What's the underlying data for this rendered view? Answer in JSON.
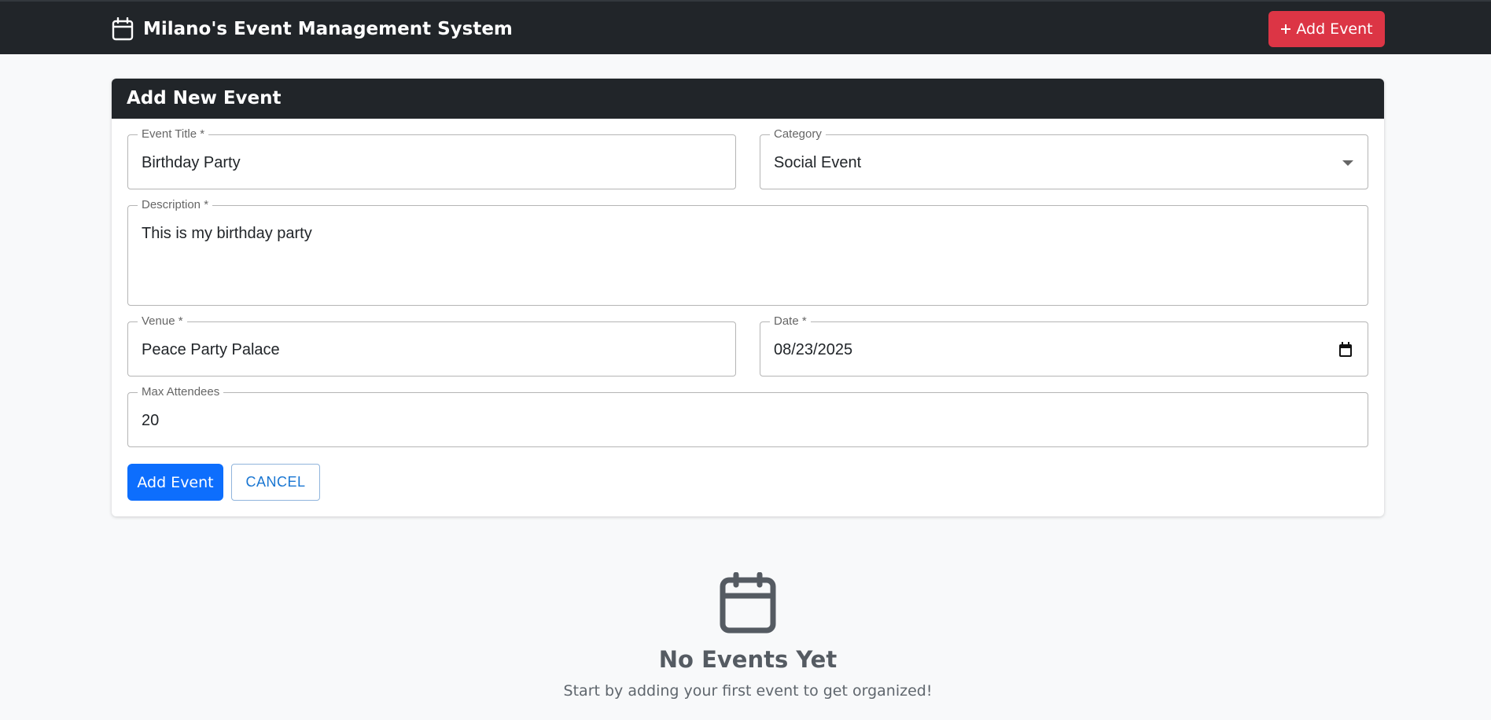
{
  "navbar": {
    "brand_icon": "calendar-icon",
    "title": "Milano's Event Management System",
    "add_button_icon": "plus-icon",
    "add_button_label": "Add Event",
    "background": "#212529",
    "accent": "#dc3545"
  },
  "form": {
    "header": "Add New Event",
    "fields": {
      "title": {
        "label": "Event Title *",
        "value": "Birthday Party"
      },
      "category": {
        "label": "Category",
        "value": "Social Event"
      },
      "description": {
        "label": "Description *",
        "value": "This is my birthday party"
      },
      "venue": {
        "label": "Venue *",
        "value": "Peace Party Palace"
      },
      "date": {
        "label": "Date *",
        "value": "08/23/2025"
      },
      "max_attendees": {
        "label": "Max Attendees",
        "value": "20"
      }
    },
    "submit_label": "Add Event",
    "cancel_label": "CANCEL",
    "primary_color": "#0d6efd"
  },
  "empty_state": {
    "icon": "calendar-icon",
    "title": "No Events Yet",
    "subtitle": "Start by adding your first event to get organized!"
  }
}
